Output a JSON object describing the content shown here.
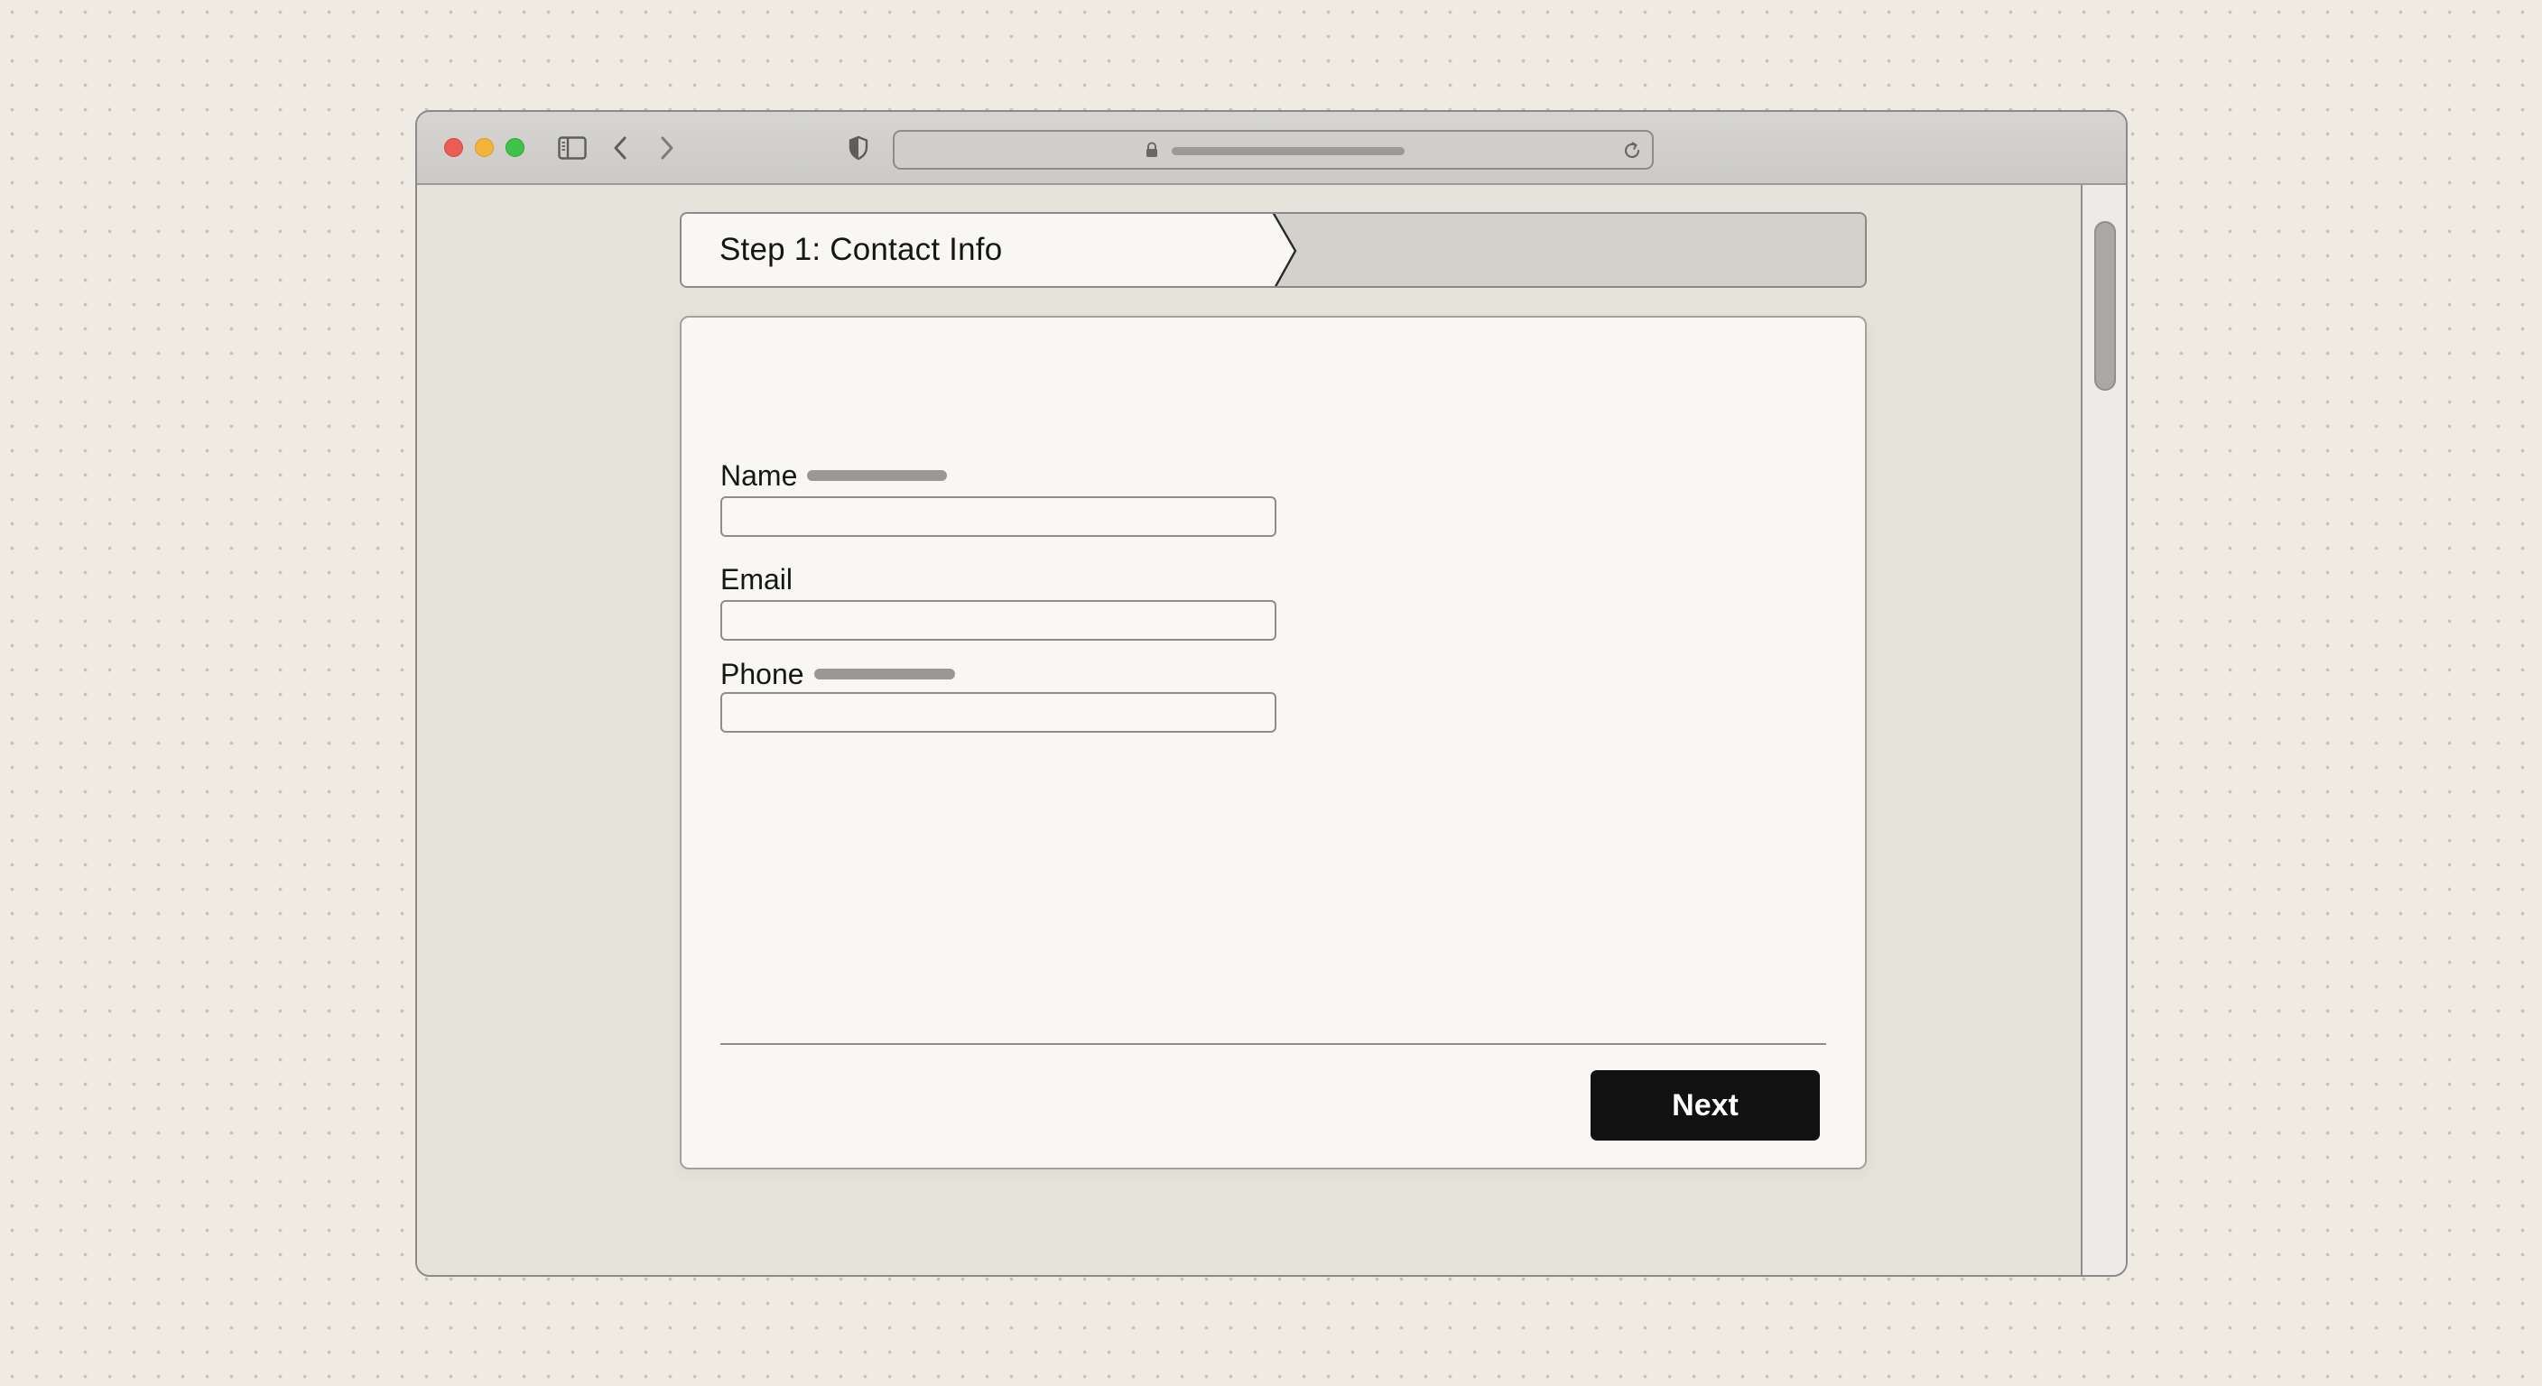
{
  "browser": {
    "icons": {
      "close": "close-dot",
      "minimize": "minimize-dot",
      "maximize": "maximize-dot",
      "sidebar": "sidebar-icon",
      "back": "chevron-left-icon",
      "forward": "chevron-right-icon",
      "privacy": "shield-icon",
      "lock": "lock-icon",
      "reload": "reload-icon",
      "share": "share-icon",
      "new_tab": "plus-icon",
      "tab_overview": "tabs-icon"
    },
    "colors": {
      "close": "#ee5b55",
      "minimize": "#f2b53a",
      "maximize": "#3fc24a"
    }
  },
  "stepper": {
    "current_step_label": "Step 1: Contact Info"
  },
  "form": {
    "fields": [
      {
        "label": "Name",
        "value": ""
      },
      {
        "label": "Email",
        "value": ""
      },
      {
        "label": "Phone",
        "value": ""
      }
    ],
    "next_label": "Next"
  }
}
